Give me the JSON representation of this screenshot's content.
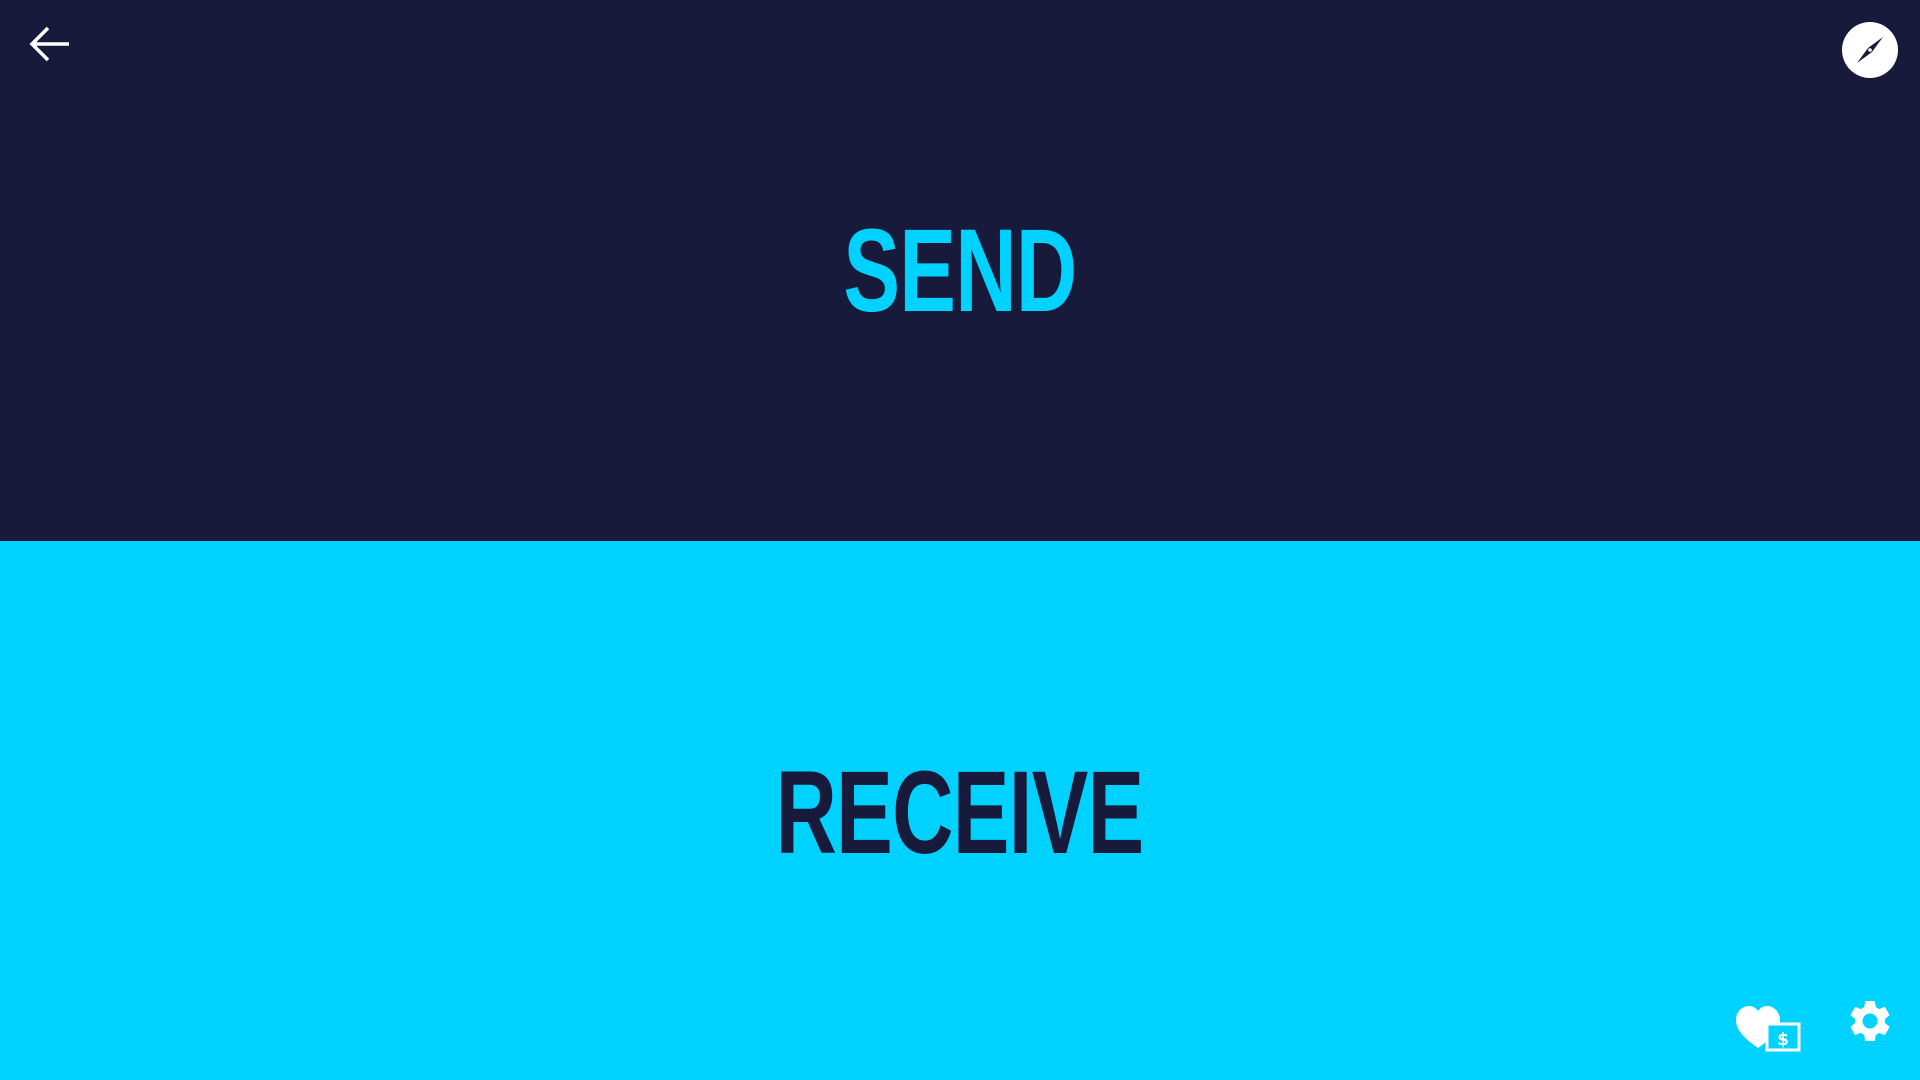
{
  "panels": {
    "send": {
      "label": "SEND"
    },
    "receive": {
      "label": "RECEIVE"
    }
  },
  "icons": {
    "back": "arrow-left-icon",
    "compass": "compass-icon",
    "donate": "heart-dollar-icon",
    "settings": "gear-icon"
  },
  "colors": {
    "dark": "#171a3a",
    "accent": "#00d2ff",
    "icon": "#ffffff"
  }
}
